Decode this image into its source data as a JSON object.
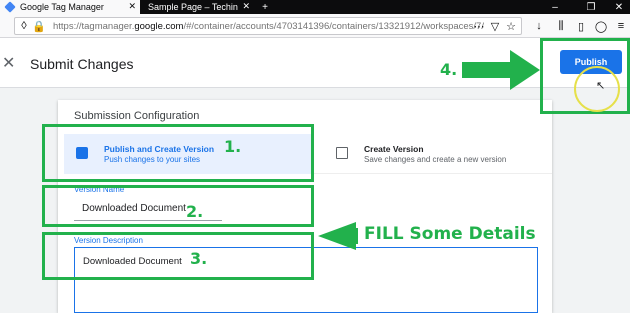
{
  "browser": {
    "tabs": [
      {
        "title": "Google Tag Manager",
        "active": true
      },
      {
        "title": "Sample Page – Techin",
        "active": false
      }
    ],
    "url_prefix": "https://tagmanager.",
    "url_domain": "google.com",
    "url_rest": "/#/container/accounts/4703141396/containers/13321912/workspaces/7/"
  },
  "header": {
    "close_icon": "close-icon",
    "title": "Submit Changes",
    "publish_label": "Publish"
  },
  "config": {
    "section_title": "Submission Configuration",
    "options": [
      {
        "title": "Publish and Create Version",
        "subtitle": "Push changes to your sites",
        "selected": true
      },
      {
        "title": "Create Version",
        "subtitle": "Save changes and create a new version",
        "selected": false
      }
    ],
    "version_name_label": "Version Name",
    "version_name_value": "Downloaded Document",
    "version_desc_label": "Version Description",
    "version_desc_value": "Downloaded Document"
  },
  "annotations": {
    "step1": "1.",
    "step2": "2.",
    "step3": "3.",
    "step4": "4.",
    "fill_text": "FILL Some Details",
    "color": "#22b14c"
  }
}
